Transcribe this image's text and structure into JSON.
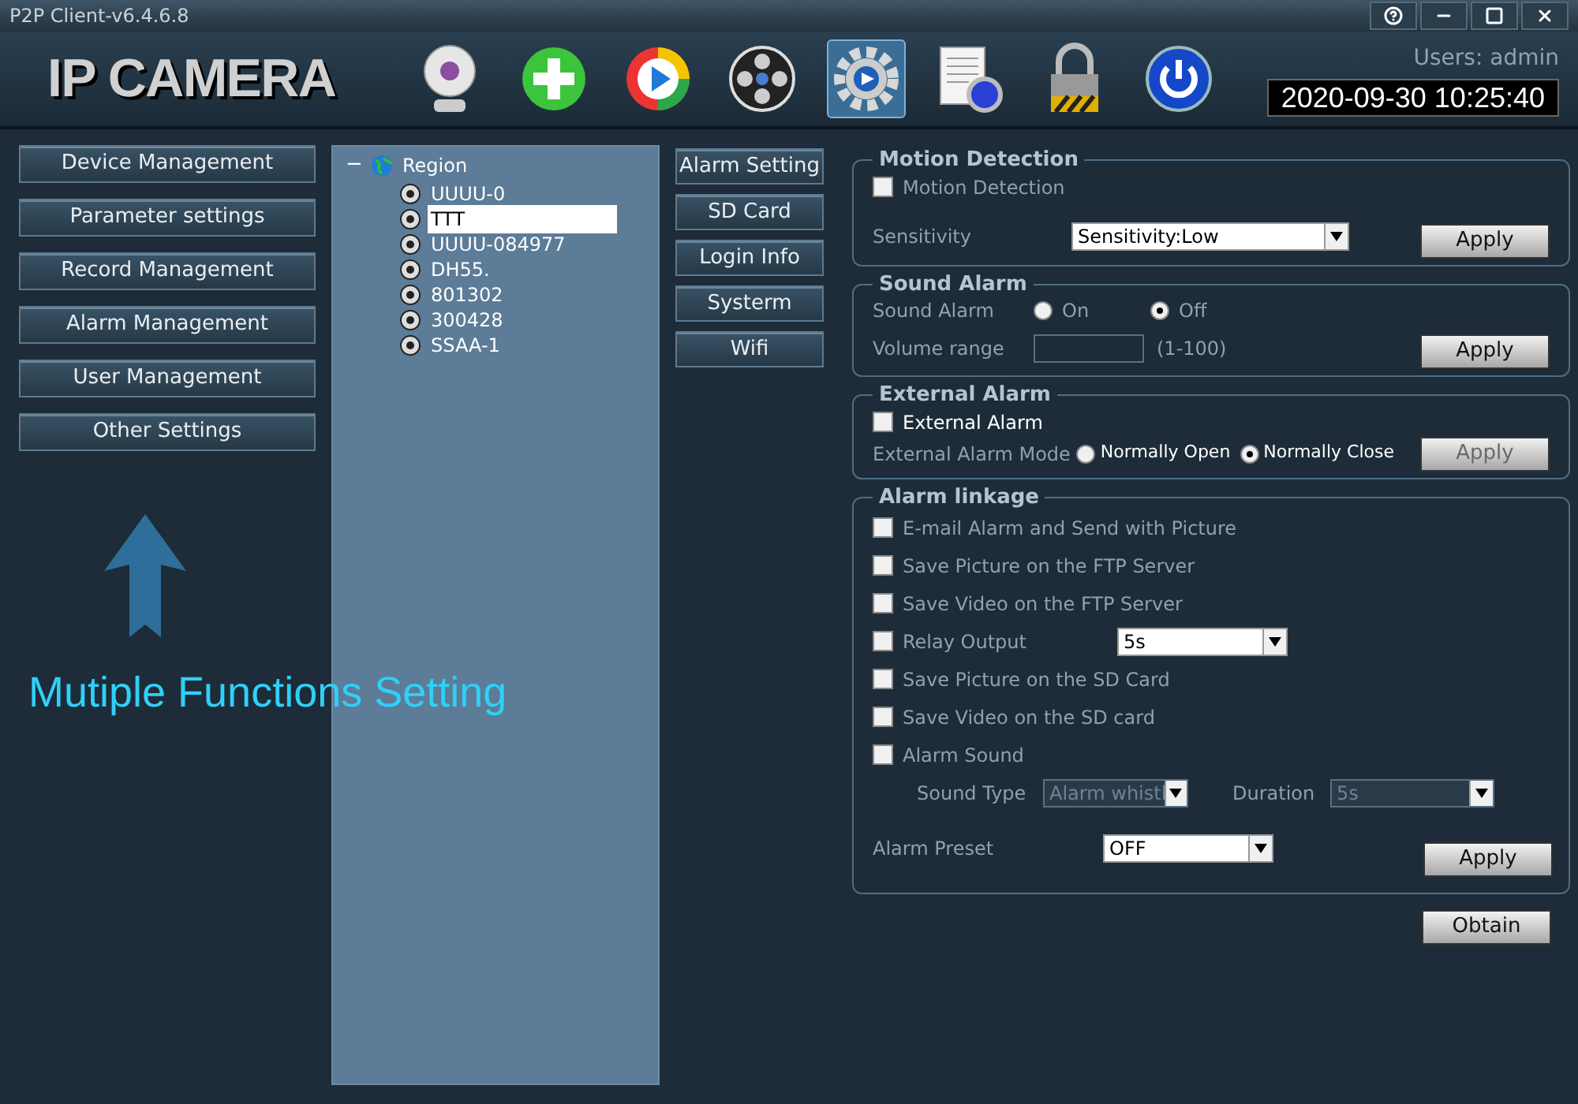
{
  "window": {
    "title": "P2P Client-v6.4.6.8"
  },
  "header": {
    "logo": "IP CAMERA",
    "user": "Users: admin",
    "datetime": "2020-09-30 10:25:40"
  },
  "toolbar": [
    {
      "kind": "webcam",
      "selected": false
    },
    {
      "kind": "add",
      "selected": false
    },
    {
      "kind": "play",
      "selected": false
    },
    {
      "kind": "reel",
      "selected": false
    },
    {
      "kind": "gear",
      "selected": true
    },
    {
      "kind": "log",
      "selected": false
    },
    {
      "kind": "lock",
      "selected": false
    },
    {
      "kind": "power",
      "selected": false
    }
  ],
  "sidebar": {
    "items": [
      "Device Management",
      "Parameter settings",
      "Record Management",
      "Alarm Management",
      "User Management",
      "Other Settings"
    ]
  },
  "annotation": {
    "text": "Mutiple Functions Setting"
  },
  "tree": {
    "label": "Region",
    "expanded": true,
    "toggle": "−",
    "children": [
      {
        "label": "UUUU-0",
        "selected": false
      },
      {
        "label": "TTT",
        "selected": true
      },
      {
        "label": "UUUU-084977",
        "selected": false
      },
      {
        "label": "DH55.",
        "selected": false
      },
      {
        "label": "801302",
        "selected": false
      },
      {
        "label": "300428",
        "selected": false
      },
      {
        "label": "SSAA-1",
        "selected": false
      }
    ]
  },
  "tabs": [
    "Alarm Setting",
    "SD Card",
    "Login Info",
    "Systerm",
    "Wifi"
  ],
  "motion": {
    "title": "Motion Detection",
    "checkbox": {
      "label": "Motion Detection",
      "checked": false
    },
    "sensitivity_label": "Sensitivity",
    "sensitivity": "Sensitivity:Low",
    "apply": "Apply"
  },
  "sound": {
    "title": "Sound Alarm",
    "label": "Sound Alarm",
    "options": [
      {
        "label": "On",
        "selected": false
      },
      {
        "label": "Off",
        "selected": true
      }
    ],
    "volume_label": "Volume range",
    "volume_hint": "(1-100)",
    "apply": "Apply"
  },
  "external": {
    "title": "External Alarm",
    "checkbox": {
      "label": "External Alarm",
      "checked": false
    },
    "mode_label": "External Alarm Mode",
    "options": [
      {
        "label": "Normally Open",
        "selected": false
      },
      {
        "label": "Normally Close",
        "selected": true
      }
    ],
    "apply": "Apply",
    "disabled": true
  },
  "linkage": {
    "title": "Alarm linkage",
    "items": [
      {
        "label": "E-mail Alarm and Send with Picture",
        "checked": false
      },
      {
        "label": "Save Picture on the FTP Server",
        "checked": false
      },
      {
        "label": "Save Video on the FTP Server",
        "checked": false
      },
      {
        "label": "Relay Output",
        "checked": false,
        "select": "5s"
      },
      {
        "label": "Save Picture on the SD Card",
        "checked": false
      },
      {
        "label": "Save Video on the SD card",
        "checked": false
      },
      {
        "label": "Alarm Sound",
        "checked": false
      }
    ],
    "sound_type_label": "Sound Type",
    "sound_type": "Alarm whistl",
    "duration_label": "Duration",
    "duration": "5s",
    "sub_disabled": true,
    "preset_label": "Alarm Preset",
    "preset": "OFF",
    "apply": "Apply"
  },
  "obtain": "Obtain"
}
